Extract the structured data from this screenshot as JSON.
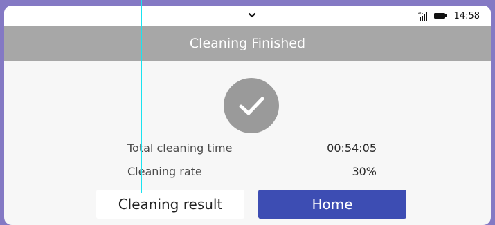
{
  "status_bar": {
    "network": "4G",
    "time": "14:58"
  },
  "header": {
    "title": "Cleaning Finished"
  },
  "result": {
    "icon": "check-icon",
    "rows": [
      {
        "label": "Total cleaning time",
        "value": "00:54:05"
      },
      {
        "label": "Cleaning rate",
        "value": "30%"
      }
    ]
  },
  "actions": {
    "result_label": "Cleaning result",
    "home_label": "Home"
  },
  "colors": {
    "background": "#8479c4",
    "title_bar": "#a7a7a7",
    "primary_button": "#3d4db3",
    "check_circle": "#9a9a9a",
    "cursor_line": "#19e3f0"
  }
}
